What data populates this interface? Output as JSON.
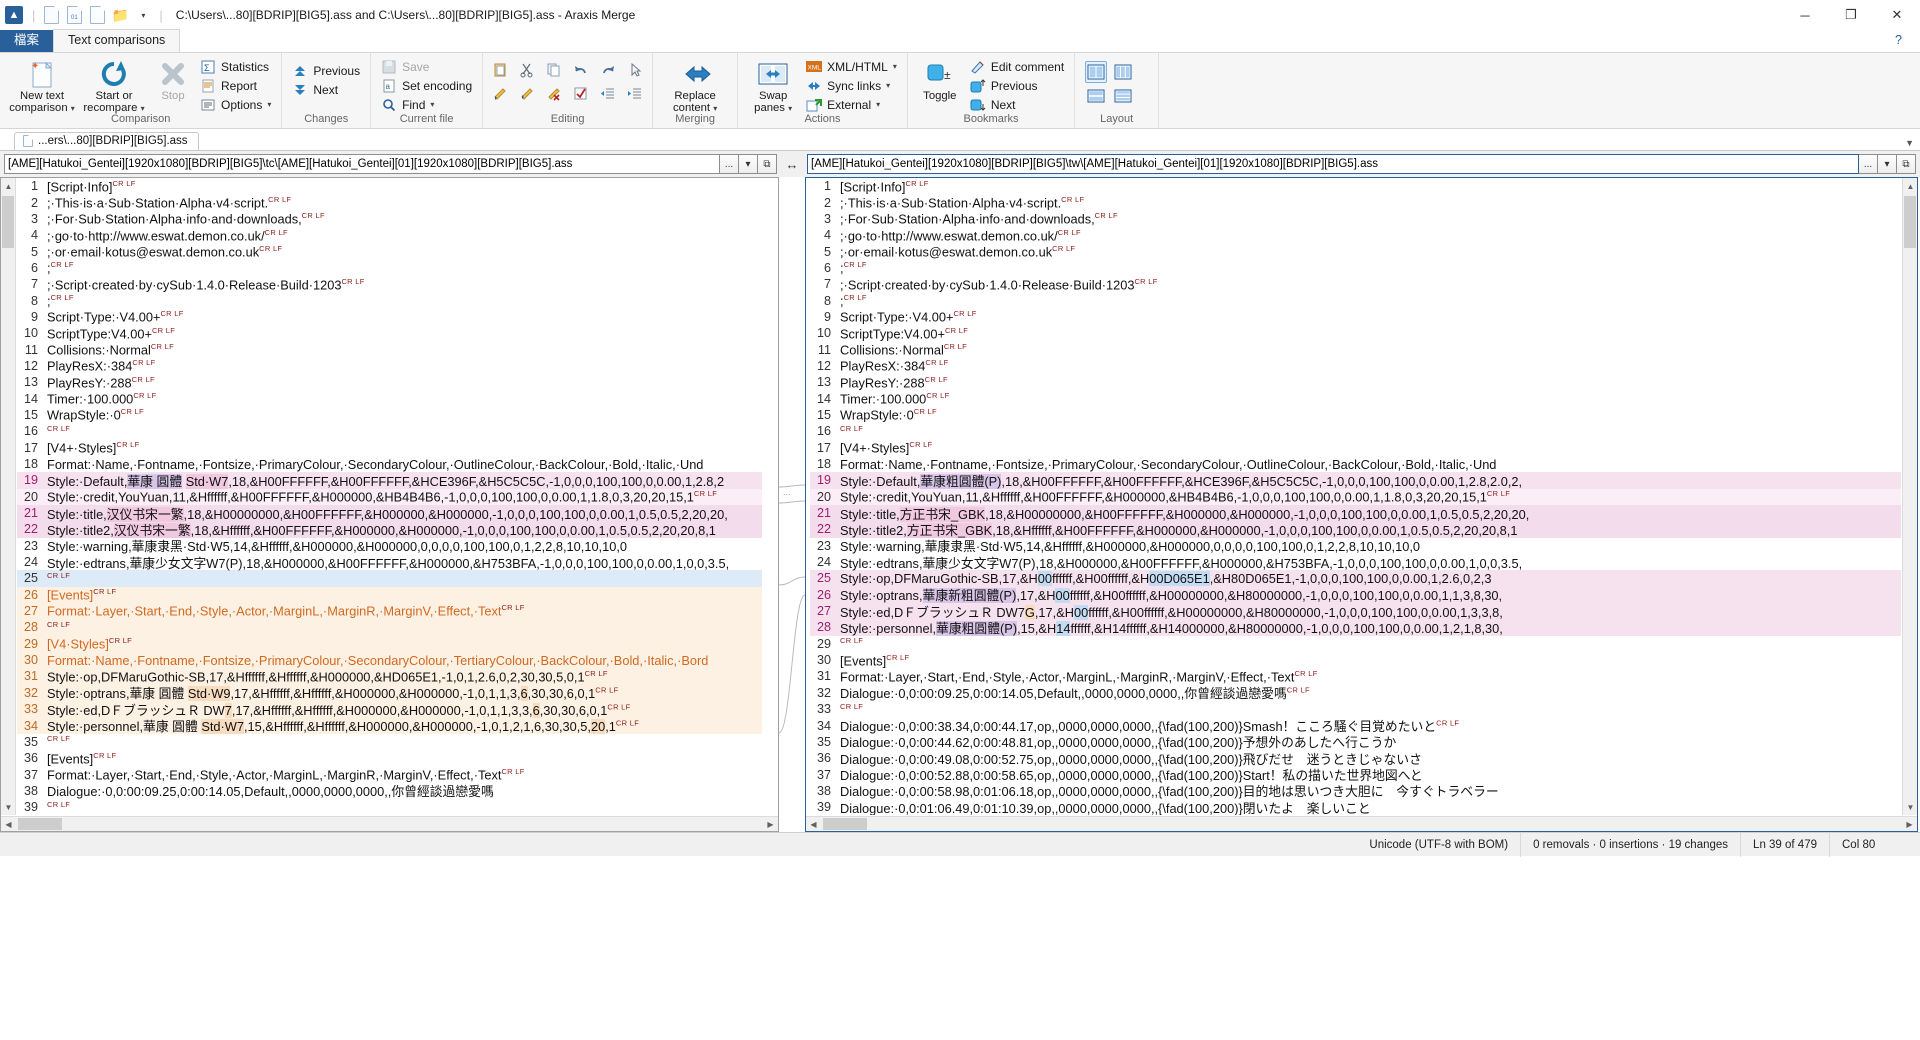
{
  "window": {
    "title": "C:\\Users\\...80][BDRIP][BIG5].ass and C:\\Users\\...80][BDRIP][BIG5].ass - Araxis Merge",
    "minimize": "─",
    "maximize": "❐",
    "close": "✕",
    "help": "?"
  },
  "quick_access": [
    "new-doc-icon",
    "new-binary-icon",
    "new-image-icon",
    "open-folder-icon",
    "qat-dropdown-icon"
  ],
  "ribbon": {
    "tabs": [
      {
        "label": "檔案",
        "style": "file"
      },
      {
        "label": "Text comparisons",
        "style": "selected"
      }
    ],
    "groups": [
      {
        "label": "Comparison",
        "big_buttons": [
          {
            "label1": "New text",
            "label2": "comparison",
            "icon": "new-text-comparison-icon",
            "dropdown": true,
            "disabled": false
          },
          {
            "label1": "Start or",
            "label2": "recompare",
            "icon": "recompare-icon",
            "dropdown": true,
            "disabled": false
          },
          {
            "label1": "Stop",
            "label2": "",
            "icon": "stop-icon",
            "dropdown": false,
            "disabled": true
          }
        ],
        "small_buttons": [
          {
            "label": "Statistics",
            "icon": "statistics-icon",
            "dropdown": false
          },
          {
            "label": "Report",
            "icon": "report-icon",
            "dropdown": false
          },
          {
            "label": "Options",
            "icon": "options-icon",
            "dropdown": true
          }
        ]
      },
      {
        "label": "Changes",
        "small_buttons": [
          {
            "label": "Previous",
            "icon": "previous-change-icon",
            "dropdown": false
          },
          {
            "label": "Next",
            "icon": "next-change-icon",
            "dropdown": false
          }
        ]
      },
      {
        "label": "Current file",
        "small_buttons": [
          {
            "label": "Save",
            "icon": "save-icon",
            "dropdown": false,
            "disabled": true
          },
          {
            "label": "Set encoding",
            "icon": "set-encoding-icon",
            "dropdown": false
          },
          {
            "label": "Find",
            "icon": "find-icon",
            "dropdown": true
          }
        ]
      },
      {
        "label": "Editing",
        "icon_rows": [
          [
            "paste-icon",
            "cut-icon",
            "copy-icon",
            "undo-icon",
            "redo-icon",
            "select-cursor-icon"
          ],
          [
            "edit-down-icon",
            "edit-up-icon",
            "edit-clear-icon",
            "check-icon",
            "outdent-icon",
            "indent-icon"
          ]
        ]
      },
      {
        "label": "Merging",
        "big_buttons": [
          {
            "label1": "Replace",
            "label2": "content",
            "icon": "replace-content-icon",
            "dropdown": true,
            "disabled": false
          }
        ]
      },
      {
        "label": "Actions",
        "big_buttons": [
          {
            "label1": "Swap",
            "label2": "panes",
            "icon": "swap-panes-icon",
            "dropdown": true,
            "disabled": false
          }
        ],
        "small_buttons": [
          {
            "label": "XML/HTML",
            "icon": "xml-html-icon",
            "dropdown": true
          },
          {
            "label": "Sync links",
            "icon": "sync-links-icon",
            "dropdown": true
          },
          {
            "label": "External",
            "icon": "external-icon",
            "dropdown": true
          }
        ]
      },
      {
        "label": "Bookmarks",
        "big_buttons": [
          {
            "label1": "Toggle",
            "label2": "",
            "icon": "toggle-bookmark-icon",
            "dropdown": false,
            "disabled": false
          }
        ],
        "small_buttons": [
          {
            "label": "Edit comment",
            "icon": "edit-comment-icon",
            "dropdown": false
          },
          {
            "label": "Previous",
            "icon": "previous-bookmark-icon",
            "dropdown": false
          },
          {
            "label": "Next",
            "icon": "next-bookmark-icon",
            "dropdown": false
          }
        ]
      },
      {
        "label": "Layout",
        "icon_rows": [
          [
            "two-pane-layout-icon",
            "three-pane-layout-icon"
          ],
          [
            "horizontal-split-icon",
            "stacked-layout-icon"
          ]
        ]
      }
    ]
  },
  "file_tab": {
    "label": "...ers\\...80][BDRIP][BIG5].ass",
    "icon": "file-icon"
  },
  "paths": {
    "left": "[AME][Hatukoi_Gentei][1920x1080][BDRIP][BIG5]\\tc\\[AME][Hatukoi_Gentei][01][1920x1080][BDRIP][BIG5].ass",
    "right": "[AME][Hatukoi_Gentei][1920x1080][BDRIP][BIG5]\\tw\\[AME][Hatukoi_Gentei][01][1920x1080][BDRIP][BIG5].ass",
    "browse_label": "...",
    "dropdown_label": "▾",
    "link_label": "⧉"
  },
  "left_pane": {
    "lines": [
      {
        "n": "1",
        "text": "[Script·Info]",
        "crlf": true
      },
      {
        "n": "2",
        "text": ";·This·is·a·Sub·Station·Alpha·v4·script.",
        "crlf": true
      },
      {
        "n": "3",
        "text": ";·For·Sub·Station·Alpha·info·and·downloads,",
        "crlf": true
      },
      {
        "n": "4",
        "text": ";·go·to·http://www.eswat.demon.co.uk/",
        "crlf": true
      },
      {
        "n": "5",
        "text": ";·or·email·kotus@eswat.demon.co.uk",
        "crlf": true
      },
      {
        "n": "6",
        "text": ";",
        "crlf": true,
        "crlf_above": true
      },
      {
        "n": "7",
        "text": ";·Script·created·by·cySub·1.4.0·Release·Build·1203",
        "crlf": true
      },
      {
        "n": "8",
        "text": ";",
        "crlf": true,
        "crlf_above": true
      },
      {
        "n": "9",
        "text": "Script·Type:·V4.00+",
        "crlf": true
      },
      {
        "n": "10",
        "text": "ScriptType:V4.00+",
        "crlf": true
      },
      {
        "n": "11",
        "text": "Collisions:·Normal",
        "crlf": true
      },
      {
        "n": "12",
        "text": "PlayResX:·384",
        "crlf": true
      },
      {
        "n": "13",
        "text": "PlayResY:·288",
        "crlf": true
      },
      {
        "n": "14",
        "text": "Timer:·100.000",
        "crlf": true
      },
      {
        "n": "15",
        "text": "WrapStyle:·0",
        "crlf": true
      },
      {
        "n": "16",
        "text": "",
        "crlf": true
      },
      {
        "n": "17",
        "text": "[V4+·Styles]",
        "crlf": true
      },
      {
        "n": "18",
        "text": "Format:·Name,·Fontname,·Fontsize,·PrimaryColour,·SecondaryColour,·OutlineColour,·BackColour,·Bold,·Italic,·Und",
        "crlf": false
      },
      {
        "n": "19",
        "text": "Style:·Default,華康 圓體 Std·W7,18,&H00FFFFFF,&H00FFFFFF,&HCE396F,&H5C5C5C,-1,0,0,0,100,100,0,0.00,1,2.8,2",
        "crlf": false,
        "diff": "pink",
        "seg": true
      },
      {
        "n": "20",
        "text": "Style:·credit,YouYuan,11,&Hffffff,&H00FFFFFF,&H000000,&HB4B4B6,-1,0,0,0,100,100,0,0.00,1,1.8,0,3,20,20,15,1",
        "crlf": true,
        "diff": "lt"
      },
      {
        "n": "21",
        "text": "Style:·title,汉仪书宋一繁,18,&H00000000,&H00FFFFFF,&H000000,&H000000,-1,0,0,0,100,100,0,0.00,1,0.5,0.5,2,20,20,",
        "crlf": false,
        "diff": "pink2"
      },
      {
        "n": "22",
        "text": "Style:·title2,汉仪书宋一繁,18,&Hffffff,&H00FFFFFF,&H000000,&H000000,-1,0,0,0,100,100,0,0.00,1,0.5,0.5,2,20,20,8,1",
        "crlf": false,
        "diff": "pink2"
      },
      {
        "n": "23",
        "text": "Style:·warning,華康隶黑·Std·W5,14,&Hffffff,&H000000,&H000000,0,0,0,0,100,100,0,1,2,2,8,10,10,10,0",
        "crlf": false
      },
      {
        "n": "24",
        "text": "Style:·edtrans,華康少女文字W7(P),18,&H000000,&H00FFFFFF,&H000000,&H753BFA,-1,0,0,0,100,100,0,0.00,1,0,0,3.5,",
        "crlf": false
      },
      {
        "n": "25",
        "text": "",
        "crlf": true,
        "diff": "sel"
      },
      {
        "n": "26",
        "text": "[Events]",
        "crlf": true,
        "diff": "peach",
        "orange": true
      },
      {
        "n": "27",
        "text": "Format:·Layer,·Start,·End,·Style,·Actor,·MarginL,·MarginR,·MarginV,·Effect,·Text",
        "crlf": true,
        "diff": "peach",
        "orange": true
      },
      {
        "n": "28",
        "text": "",
        "crlf": true,
        "diff": "peach"
      },
      {
        "n": "29",
        "text": "[V4·Styles]",
        "crlf": true,
        "diff": "peach",
        "orange": true
      },
      {
        "n": "30",
        "text": "Format:·Name,·Fontname,·Fontsize,·PrimaryColour,·SecondaryColour,·TertiaryColour,·BackColour,·Bold,·Italic,·Bord",
        "crlf": false,
        "diff": "peach",
        "orange": true
      },
      {
        "n": "31",
        "text": "Style:·op,DFMaruGothic-SB,17,&Hffffff,&Hffffff,&H000000,&HD065E1,-1,0,1,2.6,0,2,30,30,5,0,1",
        "crlf": true,
        "diff": "peach"
      },
      {
        "n": "32",
        "text": "Style:·optrans,華康 圓體 Std·W9,17,&Hffffff,&Hffffff,&H000000,&H000000,-1,0,1,1,3,6,30,30,6,0,1",
        "crlf": true,
        "diff": "peach",
        "seg2": true
      },
      {
        "n": "33",
        "text": "Style:·ed,DＦブラッシュＲ DW7,17,&Hffffff,&Hffffff,&H000000,&H000000,-1,0,1,1,3,3,6,30,30,6,0,1",
        "crlf": true,
        "diff": "peach",
        "seg2": true
      },
      {
        "n": "34",
        "text": "Style:·personnel,華康 圓體 Std·W7,15,&Hffffff,&Hffffff,&H000000,&H000000,-1,0,1,2,1,6,30,30,5,20,1",
        "crlf": true,
        "diff": "peach",
        "seg2": true
      },
      {
        "n": "35",
        "text": "",
        "crlf": true
      },
      {
        "n": "36",
        "text": "[Events]",
        "crlf": true
      },
      {
        "n": "37",
        "text": "Format:·Layer,·Start,·End,·Style,·Actor,·MarginL,·MarginR,·MarginV,·Effect,·Text",
        "crlf": true
      },
      {
        "n": "38",
        "text": "Dialogue:·0,0:00:09.25,0:00:14.05,Default,,0000,0000,0000,,你曾經談過戀愛嗎",
        "crlf": false
      },
      {
        "n": "39",
        "text": "",
        "crlf": true
      }
    ]
  },
  "right_pane": {
    "lines": [
      {
        "n": "1",
        "text": "[Script·Info]",
        "crlf": true
      },
      {
        "n": "2",
        "text": ";·This·is·a·Sub·Station·Alpha·v4·script.",
        "crlf": true
      },
      {
        "n": "3",
        "text": ";·For·Sub·Station·Alpha·info·and·downloads,",
        "crlf": true
      },
      {
        "n": "4",
        "text": ";·go·to·http://www.eswat.demon.co.uk/",
        "crlf": true
      },
      {
        "n": "5",
        "text": ";·or·email·kotus@eswat.demon.co.uk",
        "crlf": true
      },
      {
        "n": "6",
        "text": ";",
        "crlf": true,
        "crlf_above": true
      },
      {
        "n": "7",
        "text": ";·Script·created·by·cySub·1.4.0·Release·Build·1203",
        "crlf": true
      },
      {
        "n": "8",
        "text": ";",
        "crlf": true,
        "crlf_above": true
      },
      {
        "n": "9",
        "text": "Script·Type:·V4.00+",
        "crlf": true
      },
      {
        "n": "10",
        "text": "ScriptType:V4.00+",
        "crlf": true
      },
      {
        "n": "11",
        "text": "Collisions:·Normal",
        "crlf": true
      },
      {
        "n": "12",
        "text": "PlayResX:·384",
        "crlf": true
      },
      {
        "n": "13",
        "text": "PlayResY:·288",
        "crlf": true
      },
      {
        "n": "14",
        "text": "Timer:·100.000",
        "crlf": true
      },
      {
        "n": "15",
        "text": "WrapStyle:·0",
        "crlf": true
      },
      {
        "n": "16",
        "text": "",
        "crlf": true
      },
      {
        "n": "17",
        "text": "[V4+·Styles]",
        "crlf": true
      },
      {
        "n": "18",
        "text": "Format:·Name,·Fontname,·Fontsize,·PrimaryColour,·SecondaryColour,·OutlineColour,·BackColour,·Bold,·Italic,·Und",
        "crlf": false
      },
      {
        "n": "19",
        "text": "Style:·Default,華康粗圓體(P),18,&H00FFFFFF,&H00FFFFFF,&HCE396F,&H5C5C5C,-1,0,0,0,100,100,0,0.00,1,2.8,2.0,2,",
        "crlf": false,
        "diff": "pink",
        "seg": true
      },
      {
        "n": "20",
        "text": "Style:·credit,YouYuan,11,&Hffffff,&H00FFFFFF,&H000000,&HB4B4B6,-1,0,0,0,100,100,0,0.00,1,1.8,0,3,20,20,15,1",
        "crlf": true,
        "diff": "lt"
      },
      {
        "n": "21",
        "text": "Style:·title,方正书宋_GBK,18,&H00000000,&H00FFFFFF,&H000000,&H000000,-1,0,0,0,100,100,0,0.00,1,0.5,0.5,2,20,20,",
        "crlf": false,
        "diff": "pink2"
      },
      {
        "n": "22",
        "text": "Style:·title2,方正书宋_GBK,18,&Hffffff,&H00FFFFFF,&H000000,&H000000,-1,0,0,0,100,100,0,0.00,1,0.5,0.5,2,20,20,8,1",
        "crlf": false,
        "diff": "pink2"
      },
      {
        "n": "23",
        "text": "Style:·warning,華康隶黑·Std·W5,14,&Hffffff,&H000000,&H000000,0,0,0,0,100,100,0,1,2,2,8,10,10,10,0",
        "crlf": false
      },
      {
        "n": "24",
        "text": "Style:·edtrans,華康少女文字W7(P),18,&H000000,&H00FFFFFF,&H000000,&H753BFA,-1,0,0,0,100,100,0,0.00,1,0,0,3.5,",
        "crlf": false
      },
      {
        "n": "25",
        "text": "Style:·op,DFMaruGothic-SB,17,&H00ffffff,&H00ffffff,&H00D065E1,&H80D065E1,-1,0,0,0,100,100,0,0.00,1,2.6,0,2,3",
        "crlf": false,
        "diff": "pink",
        "seg3": true
      },
      {
        "n": "26",
        "text": "Style:·optrans,華康新粗圓體(P),17,&H00ffffff,&H00ffffff,&H00000000,&H80000000,-1,0,0,0,100,100,0,0.00,1,1,3,8,30,",
        "crlf": false,
        "diff": "pink",
        "seg3": true
      },
      {
        "n": "27",
        "text": "Style:·ed,DＦブラッシュＲ DW7G,17,&H00ffffff,&H00ffffff,&H00000000,&H80000000,-1,0,0,0,100,100,0,0.00,1,3,3,8,",
        "crlf": false,
        "diff": "pink",
        "seg3": true
      },
      {
        "n": "28",
        "text": "Style:·personnel,華康粗圓體(P),15,&H14ffffff,&H14ffffff,&H14000000,&H80000000,-1,0,0,0,100,100,0,0.00,1,2,1,8,30,",
        "crlf": false,
        "diff": "pink",
        "seg3": true
      },
      {
        "n": "29",
        "text": "",
        "crlf": true
      },
      {
        "n": "30",
        "text": "[Events]",
        "crlf": true
      },
      {
        "n": "31",
        "text": "Format:·Layer,·Start,·End,·Style,·Actor,·MarginL,·MarginR,·MarginV,·Effect,·Text",
        "crlf": true
      },
      {
        "n": "32",
        "text": "Dialogue:·0,0:00:09.25,0:00:14.05,Default,,0000,0000,0000,,你曾經談過戀愛嗎",
        "crlf": true
      },
      {
        "n": "33",
        "text": "",
        "crlf": true
      },
      {
        "n": "34",
        "text": "Dialogue:·0,0:00:38.34,0:00:44.17,op,,0000,0000,0000,,{\\fad(100,200)}Smash！こころ騒ぐ目覚めたいと",
        "crlf": true
      },
      {
        "n": "35",
        "text": "Dialogue:·0,0:00:44.62,0:00:48.81,op,,0000,0000,0000,,{\\fad(100,200)}予想外のあしたへ行こうか",
        "crlf": false
      },
      {
        "n": "36",
        "text": "Dialogue:·0,0:00:49.08,0:00:52.75,op,,0000,0000,0000,,{\\fad(100,200)}飛びだせ　迷うときじゃないさ",
        "crlf": false
      },
      {
        "n": "37",
        "text": "Dialogue:·0,0:00:52.88,0:00:58.65,op,,0000,0000,0000,,{\\fad(100,200)}Start！私の描いた世界地図へと",
        "crlf": false
      },
      {
        "n": "38",
        "text": "Dialogue:·0,0:00:58.98,0:01:06.18,op,,0000,0000,0000,,{\\fad(100,200)}目的地は思いつき大胆に　今すぐトラベラー",
        "crlf": false
      },
      {
        "n": "39",
        "text": "Dialogue:·0,0:01:06.49,0:01:10.39,op,,0000,0000,0000,,{\\fad(100,200)}閉いたよ　楽しいこと",
        "crlf": false
      }
    ]
  },
  "status": {
    "encoding": "Unicode (UTF-8 with BOM)",
    "changes": "0 removals · 0 insertions · 19 changes",
    "line": "Ln 39 of 479",
    "col": "Col 80"
  }
}
